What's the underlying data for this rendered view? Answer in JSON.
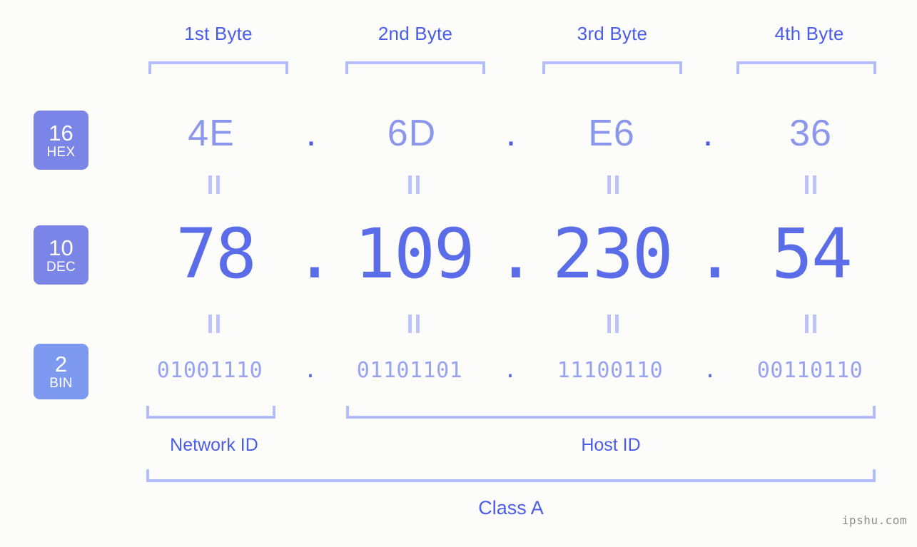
{
  "meta": {
    "watermark": "ipshu.com",
    "background_color": "#fcfdfa",
    "accent_color": "#4a5ce8",
    "bracket_color": "#b4bdfb",
    "badge_color": "#7b85e8",
    "badge_bin_color": "#7e9af0"
  },
  "byte_headers": [
    {
      "label": "1st Byte"
    },
    {
      "label": "2nd Byte"
    },
    {
      "label": "3rd Byte"
    },
    {
      "label": "4th Byte"
    }
  ],
  "rows": {
    "hex": {
      "badge_num": "16",
      "badge_sub": "HEX",
      "values": [
        "4E",
        "6D",
        "E6",
        "36"
      ],
      "separator": "."
    },
    "dec": {
      "badge_num": "10",
      "badge_sub": "DEC",
      "values": [
        "78",
        "109",
        "230",
        "54"
      ],
      "separator": "."
    },
    "bin": {
      "badge_num": "2",
      "badge_sub": "BIN",
      "values": [
        "01001110",
        "01101101",
        "11100110",
        "00110110"
      ],
      "separator": "."
    }
  },
  "equals_glyph": "=",
  "sections": {
    "network_id": "Network ID",
    "host_id": "Host ID",
    "class": "Class A"
  },
  "ip_address": "78.109.230.54"
}
